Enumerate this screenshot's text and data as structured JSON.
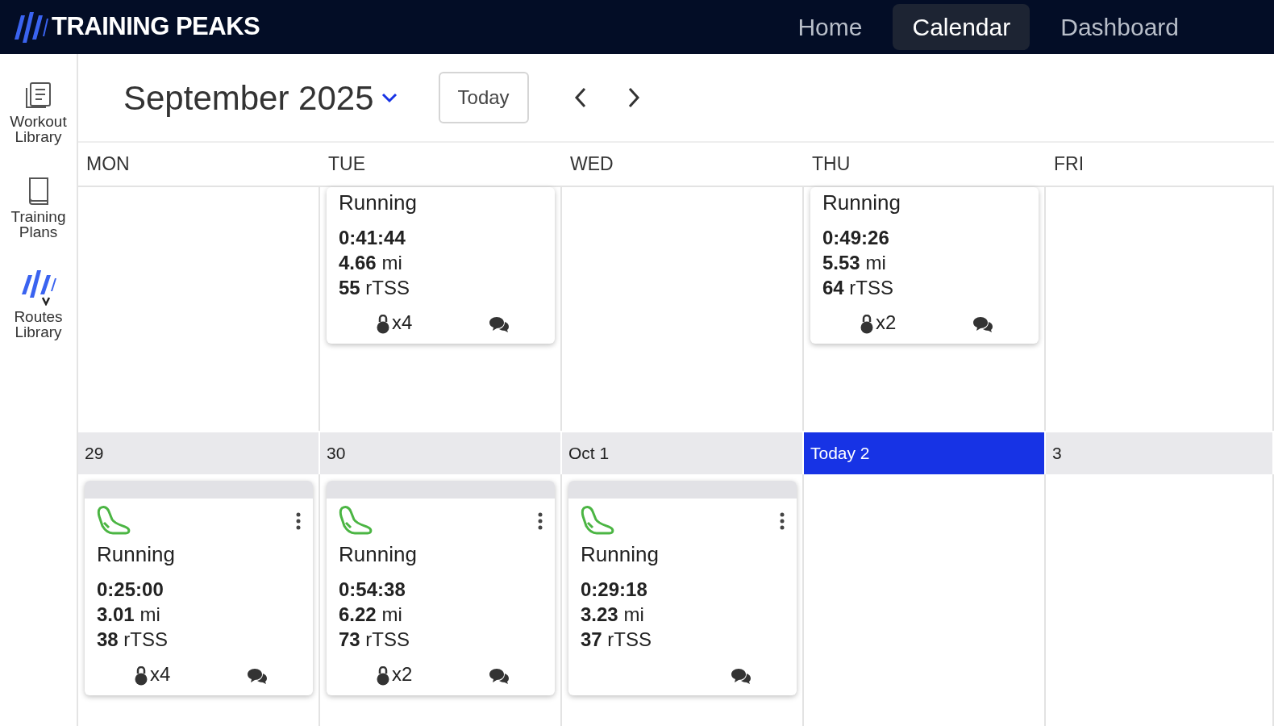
{
  "brand": {
    "name": "TRAINING PEAKS"
  },
  "nav": [
    {
      "label": "Home",
      "selected": false
    },
    {
      "label": "Calendar",
      "selected": true
    },
    {
      "label": "Dashboard",
      "selected": false
    }
  ],
  "sidebar": {
    "items": [
      {
        "label": "Workout Library",
        "kind": "library"
      },
      {
        "label": "Training Plans",
        "kind": "plans"
      },
      {
        "label": "Routes Library",
        "kind": "routes"
      }
    ]
  },
  "header": {
    "month": "September 2025",
    "today_button": "Today"
  },
  "weekdays": [
    "MON",
    "TUE",
    "WED",
    "THU",
    "FRI"
  ],
  "weeks": [
    {
      "days": [
        {
          "kind": "blank"
        },
        {
          "kind": "filled",
          "workout": {
            "kind": "partial",
            "title": "Running",
            "duration": "0:41:44",
            "distance": "**4.66** mi",
            "tss": "**55** rTSS",
            "strength": "x4"
          }
        },
        {
          "kind": "blank"
        },
        {
          "kind": "filled",
          "workout": {
            "kind": "partial",
            "title": "Running",
            "duration": "0:49:26",
            "distance": "**5.53** mi",
            "tss": "**64** rTSS",
            "strength": "x2"
          }
        },
        {
          "kind": "blank"
        }
      ]
    },
    {
      "days": [
        {
          "date": "29",
          "today": false,
          "workout": {
            "kind": "full",
            "title": "Running",
            "duration": "0:25:00",
            "distance": "**3.01** mi",
            "tss": "**38** rTSS",
            "strength": "x4"
          }
        },
        {
          "date": "30",
          "today": false,
          "workout": {
            "kind": "full",
            "title": "Running",
            "duration": "0:54:38",
            "distance": "**6.22** mi",
            "tss": "**73** rTSS",
            "strength": "x2"
          }
        },
        {
          "date": "Oct 1",
          "today": false,
          "workout": {
            "kind": "full",
            "title": "Running",
            "duration": "0:29:18",
            "distance": "**3.23** mi",
            "tss": "**37** rTSS"
          }
        },
        {
          "date": "Today 2",
          "today": true
        },
        {
          "date": "3",
          "today": false
        }
      ]
    }
  ]
}
